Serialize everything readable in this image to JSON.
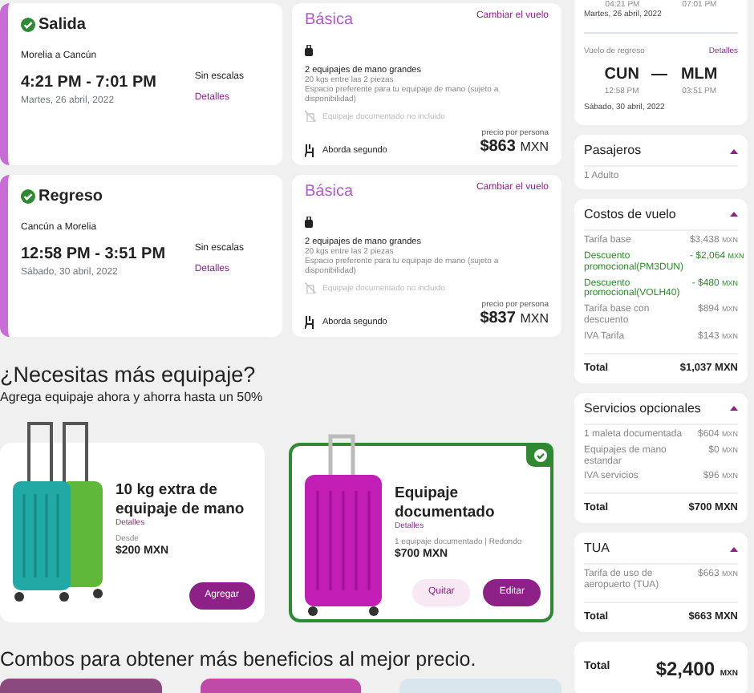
{
  "flights": [
    {
      "title": "Salida",
      "confirmed": true,
      "route": "Morelia a Cancún",
      "times": "4:21 PM - 7:01 PM",
      "date": "Martes, 26 abril, 2022",
      "stops": "Sin escalas",
      "details": "Detalles",
      "fare": "Básica",
      "change": "Cambiar el vuelo",
      "features": [
        {
          "kind": "carry_on",
          "title": "2 equipajes de mano grandes",
          "lines": [
            "20 kgs entre las 2 piezas",
            "Espacio preferente para tu equipaje de mano (sujeto a disponibilidad)"
          ]
        },
        {
          "kind": "not_included",
          "title": "Equipaje documentado no incluido"
        },
        {
          "kind": "boarding",
          "title": "Aborda segundo"
        }
      ],
      "price_label": "precio por persona",
      "price": "$863",
      "currency": "MXN"
    },
    {
      "title": "Regreso",
      "confirmed": true,
      "route": "Cancún a Morelia",
      "times": "12:58 PM - 3:51 PM",
      "date": "Sábado, 30 abril, 2022",
      "stops": "Sin escalas",
      "details": "Detalles",
      "fare": "Básica",
      "change": "Cambiar el vuelo",
      "features": [
        {
          "kind": "carry_on",
          "title": "2 equipajes de mano grandes",
          "lines": [
            "20 kgs entre las 2 piezas",
            "Espacio preferente para tu equipaje de mano (sujeto a disponibilidad)"
          ]
        },
        {
          "kind": "not_included",
          "title": "Equipaje documentado no incluido"
        },
        {
          "kind": "boarding",
          "title": "Aborda segundo"
        }
      ],
      "price_label": "precio por persona",
      "price": "$837",
      "currency": "MXN"
    }
  ],
  "baggage": {
    "title": "¿Necesitas más equipaje?",
    "subtitle": "Agrega equipaje ahora y ahorra hasta un 50%",
    "items": [
      {
        "kind": "pair",
        "title": "10 kg extra de equipaje de mano",
        "details": "Detalles",
        "note": "Desde",
        "price": "$200 MXN",
        "selected": false,
        "buttons": [
          {
            "kind": "primary",
            "label": "Agregar"
          }
        ]
      },
      {
        "kind": "single",
        "title": "Equipaje documentado",
        "details": "Detalles",
        "note": "1 equipaje documentado | Redondo",
        "price": "$700 MXN",
        "selected": true,
        "buttons": [
          {
            "kind": "secondary",
            "label": "Quitar"
          },
          {
            "kind": "primary",
            "label": "Editar"
          }
        ]
      }
    ]
  },
  "combos": {
    "title": "Combos para obtener más beneficios al mejor precio."
  },
  "summary": {
    "depart_times": [
      "04:21 PM",
      "07:01 PM"
    ],
    "depart_date": "Martes, 26 abril, 2022",
    "return_label": "Vuelo de regreso",
    "return_details": "Detalles",
    "from": "CUN",
    "to": "MLM",
    "from_time": "12:58 PM",
    "to_time": "03:51 PM",
    "return_date": "Sábado, 30 abril, 2022",
    "sections": [
      {
        "title": "Pasajeros",
        "expanded": true,
        "rows": [
          {
            "kind": "normal",
            "label": "1 Adulto"
          }
        ]
      },
      {
        "title": "Costos de vuelo",
        "expanded": true,
        "rows": [
          {
            "kind": "normal",
            "label": "Tarifa base",
            "amount": "$3,438",
            "currency": "MXN"
          },
          {
            "kind": "discount",
            "label": "Descuento promocional(PM3DUN)",
            "amount": "- $2,064",
            "currency": "MXN"
          },
          {
            "kind": "discount",
            "label": "Descuento promocional(VOLH40)",
            "amount": "- $480",
            "currency": "MXN"
          },
          {
            "kind": "normal",
            "label": "Tarifa base con descuento",
            "amount": "$894",
            "currency": "MXN"
          },
          {
            "kind": "normal",
            "label": "IVA Tarifa",
            "amount": "$143",
            "currency": "MXN"
          }
        ],
        "total_label": "Total",
        "total": "$1,037 MXN"
      },
      {
        "title": "Servicios opcionales",
        "expanded": true,
        "rows": [
          {
            "kind": "normal",
            "label": "1 maleta documentada",
            "amount": "$604",
            "currency": "MXN"
          },
          {
            "kind": "normal",
            "label": "Equipajes de mano estandar",
            "amount": "$0",
            "currency": "MXN"
          },
          {
            "kind": "normal",
            "label": "IVA servicios",
            "amount": "$96",
            "currency": "MXN"
          }
        ],
        "total_label": "Total",
        "total": "$700 MXN"
      },
      {
        "title": "TUA",
        "expanded": true,
        "rows": [
          {
            "kind": "normal",
            "label": "Tarifa de uso de aeropuerto (TUA)",
            "amount": "$663",
            "currency": "MXN"
          }
        ],
        "total_label": "Total",
        "total": "$663 MXN"
      }
    ],
    "grand_total_label": "Total",
    "grand_total": "$2,400",
    "grand_currency": "MXN"
  }
}
